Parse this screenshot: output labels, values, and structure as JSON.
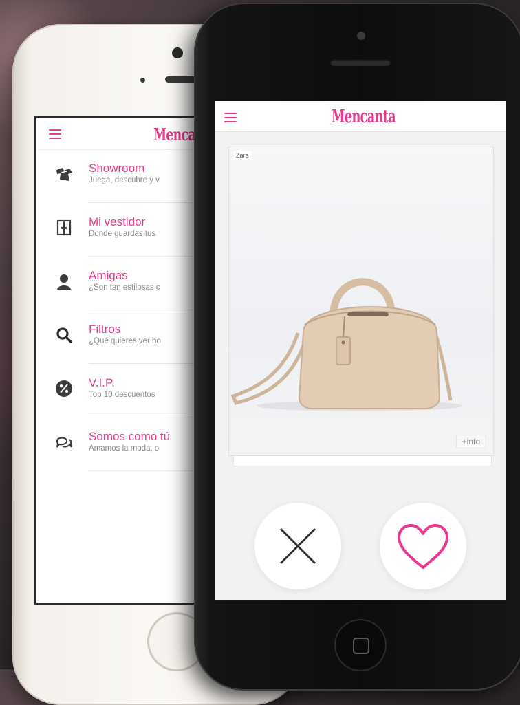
{
  "app": {
    "name": "Mencanta",
    "accent_color": "#e8388f"
  },
  "menu_phone": {
    "items": [
      {
        "title": "Showroom",
        "subtitle": "Juega, descubre y v",
        "icon": "shirts-icon"
      },
      {
        "title": "Mi vestidor",
        "subtitle": "Donde guardas tus",
        "icon": "wardrobe-icon"
      },
      {
        "title": "Amigas",
        "subtitle": "¿Son tan estilosas c",
        "icon": "person-icon"
      },
      {
        "title": "Filtros",
        "subtitle": "¿Qué quieres ver ho",
        "icon": "search-icon"
      },
      {
        "title": "V.I.P.",
        "subtitle": "Top 10 descuentos",
        "icon": "percent-icon"
      },
      {
        "title": "Somos como tú",
        "subtitle": "Amamos la moda, o",
        "icon": "chat-icon"
      }
    ]
  },
  "swipe_phone": {
    "card": {
      "brand": "Zara",
      "more_info": "+info",
      "product_icon": "handbag-image"
    },
    "actions": {
      "dislike_icon": "close-x-icon",
      "like_icon": "heart-icon"
    }
  }
}
